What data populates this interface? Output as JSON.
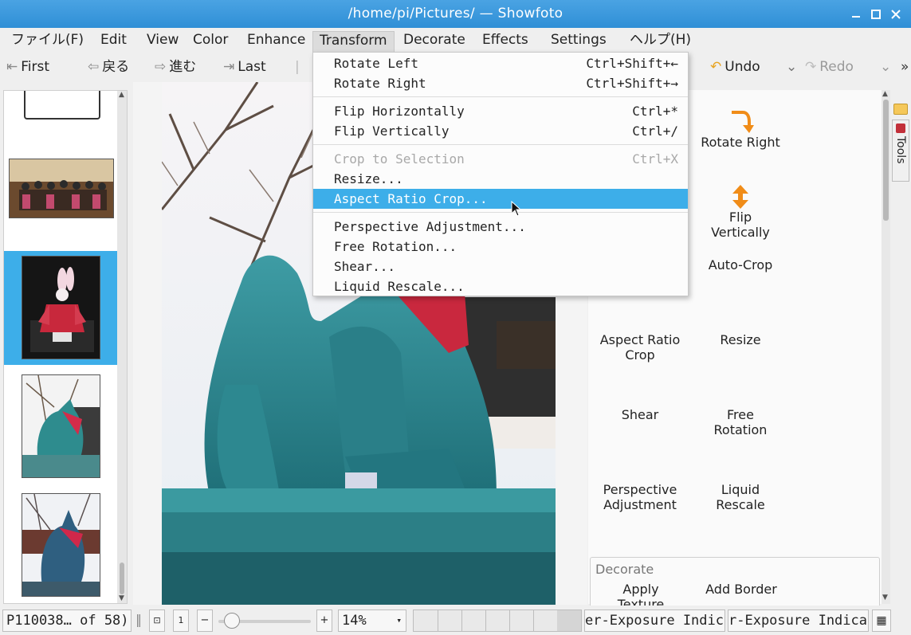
{
  "window": {
    "title": "/home/pi/Pictures/ — Showfoto"
  },
  "menubar": [
    "ファイル(F)",
    "Edit",
    "View",
    "Color",
    "Enhance",
    "Transform",
    "Decorate",
    "Effects",
    "Settings",
    "ヘルプ(H)"
  ],
  "toolbar": {
    "first": "First",
    "back": "戻る",
    "forward": "進む",
    "last": "Last",
    "undo": "Undo",
    "redo": "Redo"
  },
  "transform_menu": {
    "items": [
      {
        "label": "Rotate Left",
        "shortcut": "Ctrl+Shift+←"
      },
      {
        "label": "Rotate Right",
        "shortcut": "Ctrl+Shift+→"
      },
      {
        "label": "Flip Horizontally",
        "shortcut": "Ctrl+*"
      },
      {
        "label": "Flip Vertically",
        "shortcut": "Ctrl+/"
      },
      {
        "label": "Crop to Selection",
        "shortcut": "Ctrl+X"
      },
      {
        "label": "Resize...",
        "shortcut": ""
      },
      {
        "label": "Aspect Ratio Crop...",
        "shortcut": ""
      },
      {
        "label": "Perspective Adjustment...",
        "shortcut": ""
      },
      {
        "label": "Free Rotation...",
        "shortcut": ""
      },
      {
        "label": "Shear...",
        "shortcut": ""
      },
      {
        "label": "Liquid Rescale...",
        "shortcut": ""
      }
    ]
  },
  "tools_panel": {
    "rotate_right": "Rotate Right",
    "flip_vertically": "Flip\nVertically",
    "auto_crop": "Auto-Crop",
    "aspect_ratio_crop": "Aspect Ratio\nCrop",
    "resize": "Resize",
    "shear": "Shear",
    "free_rotation": "Free\nRotation",
    "perspective_adjustment": "Perspective\nAdjustment",
    "liquid_rescale": "Liquid\nRescale",
    "decorate_header": "Decorate",
    "apply_texture": "Apply\nTexture",
    "add_border": "Add Border",
    "side_tab": "Tools"
  },
  "statusbar": {
    "file_info": "P110038… of 58)",
    "zoom": "14%",
    "indicator1": "er-Exposure Indica",
    "indicator2": "r-Exposure Indica"
  },
  "colors": {
    "accent": "#3daee9",
    "titlebar": "#3b99dc",
    "photo_teal": "#2c7f86"
  }
}
